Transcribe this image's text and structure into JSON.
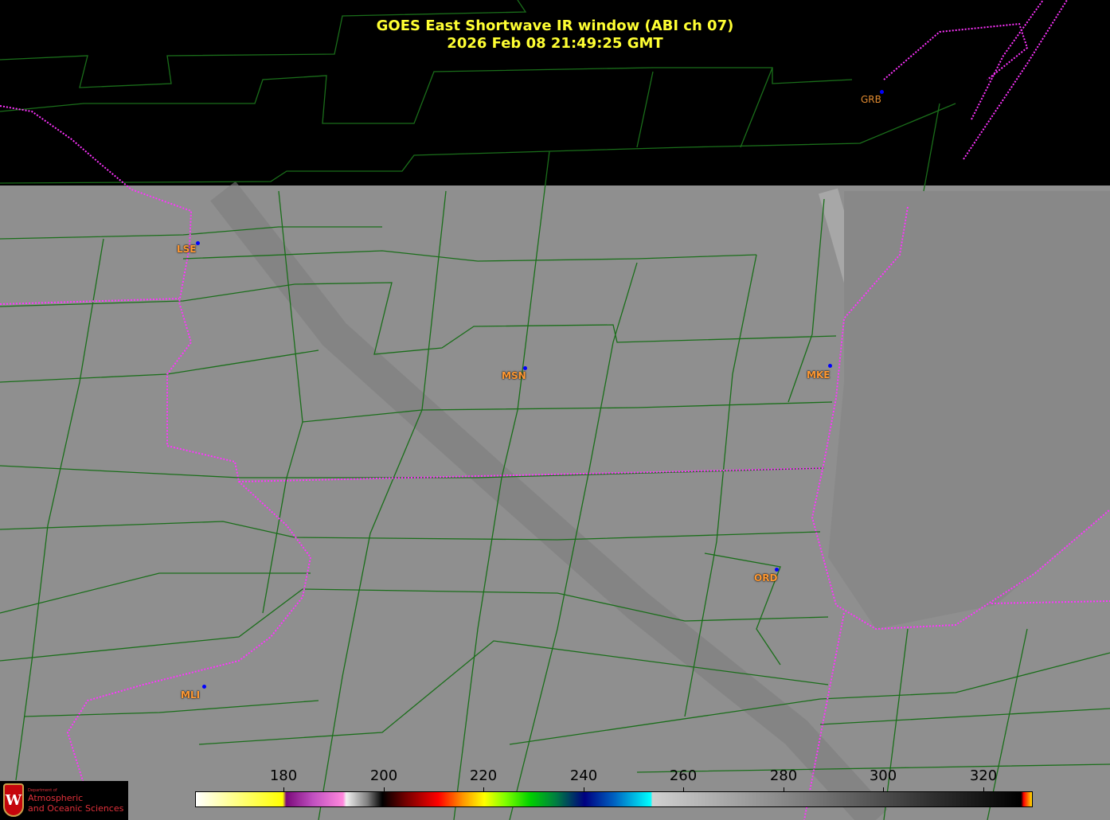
{
  "title": {
    "line1": "GOES East Shortwave IR window (ABI ch 07)",
    "line2": "2026 Feb 08  21:49:25 GMT"
  },
  "stations": [
    {
      "id": "GRB",
      "label": "GRB"
    },
    {
      "id": "LSE",
      "label": "LSE"
    },
    {
      "id": "MSN",
      "label": "MSN"
    },
    {
      "id": "MKE",
      "label": "MKE"
    },
    {
      "id": "ORD",
      "label": "ORD"
    },
    {
      "id": "MLI",
      "label": "MLI"
    }
  ],
  "colorbar": {
    "ticks": [
      "180",
      "200",
      "220",
      "240",
      "260",
      "280",
      "300",
      "320"
    ],
    "unit_range_K": [
      162,
      330
    ]
  },
  "logo": {
    "dept": "Department of",
    "line1": "Atmospheric",
    "line2": "and Oceanic Sciences",
    "crest_letter": "W"
  },
  "colors": {
    "county": "#1a6e1a",
    "state": "#ff33ff",
    "title": "#ffff33",
    "station": "#ff9933"
  }
}
